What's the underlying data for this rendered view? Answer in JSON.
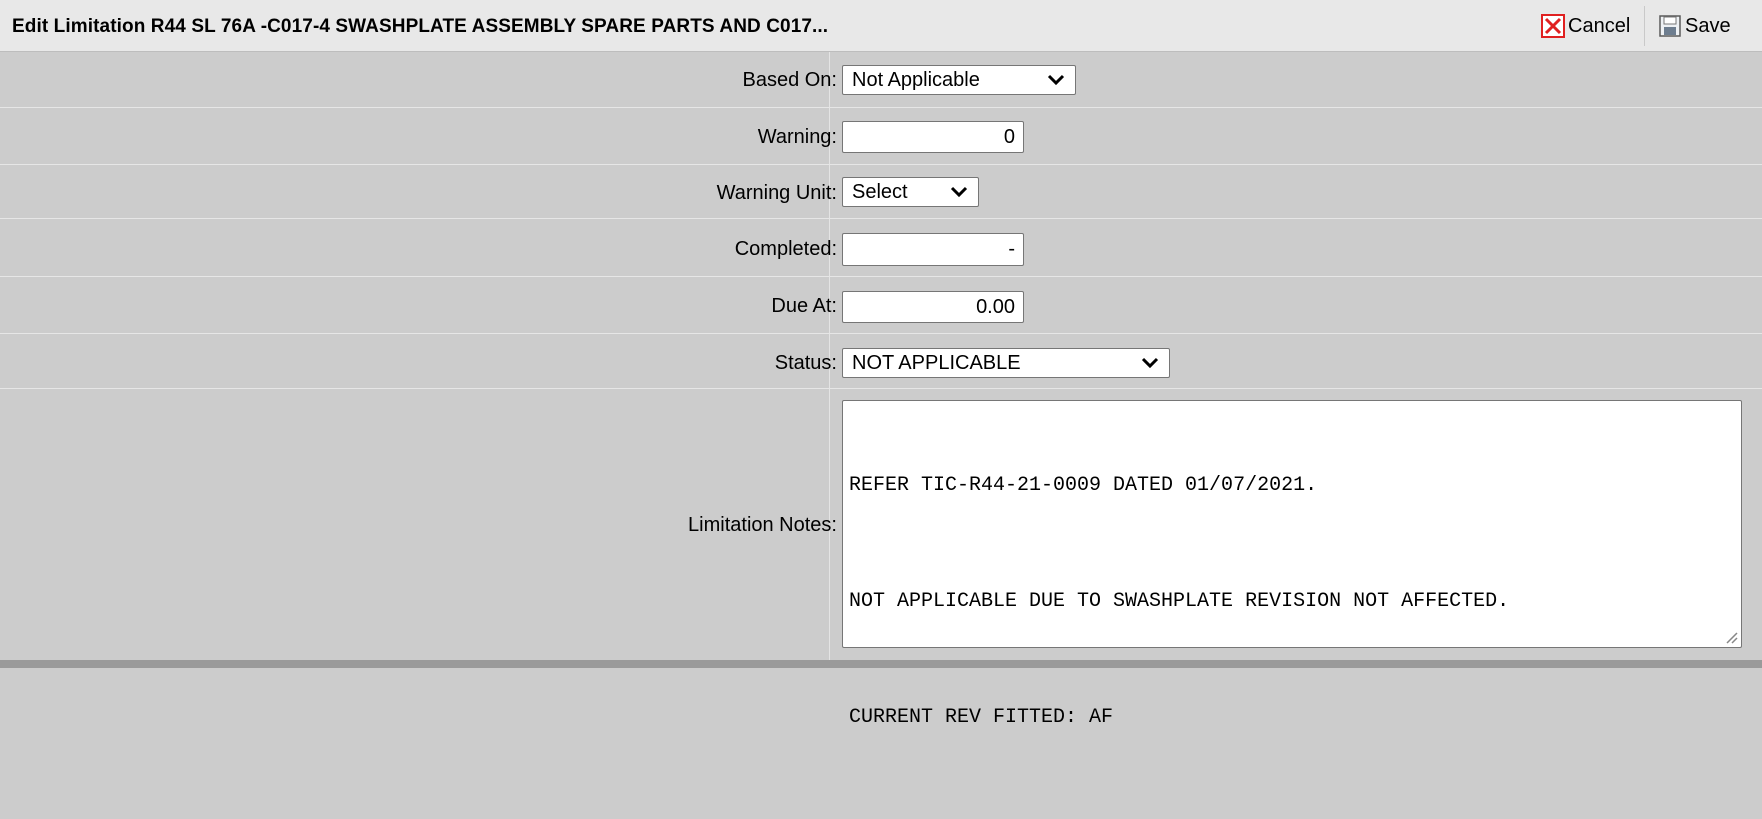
{
  "header": {
    "title": "Edit Limitation R44 SL 76A -C017-4 SWASHPLATE ASSEMBLY SPARE PARTS AND C017...",
    "cancel_label": "Cancel",
    "save_label": "Save"
  },
  "form": {
    "based_on": {
      "label": "Based On:",
      "value": "Not Applicable"
    },
    "warning": {
      "label": "Warning:",
      "value": "0"
    },
    "warning_unit": {
      "label": "Warning Unit:",
      "value": "Select"
    },
    "completed": {
      "label": "Completed:",
      "value": "-"
    },
    "due_at": {
      "label": "Due At:",
      "value": "0.00"
    },
    "status": {
      "label": "Status:",
      "value": "NOT APPLICABLE"
    },
    "limitation_notes": {
      "label": "Limitation Notes:",
      "lines": [
        "REFER TIC-R44-21-0009 DATED 01/07/2021.",
        "NOT APPLICABLE DUE TO SWASHPLATE REVISION NOT AFFECTED.",
        "CURRENT REV FITTED: AF"
      ]
    }
  },
  "colors": {
    "background": "#cccccc",
    "titlebar": "#e8e8e8",
    "cancel_icon": "#e02020"
  },
  "icons": [
    "cancel-x-icon",
    "save-floppy-icon",
    "chevron-down-icon",
    "resize-grip-icon"
  ]
}
